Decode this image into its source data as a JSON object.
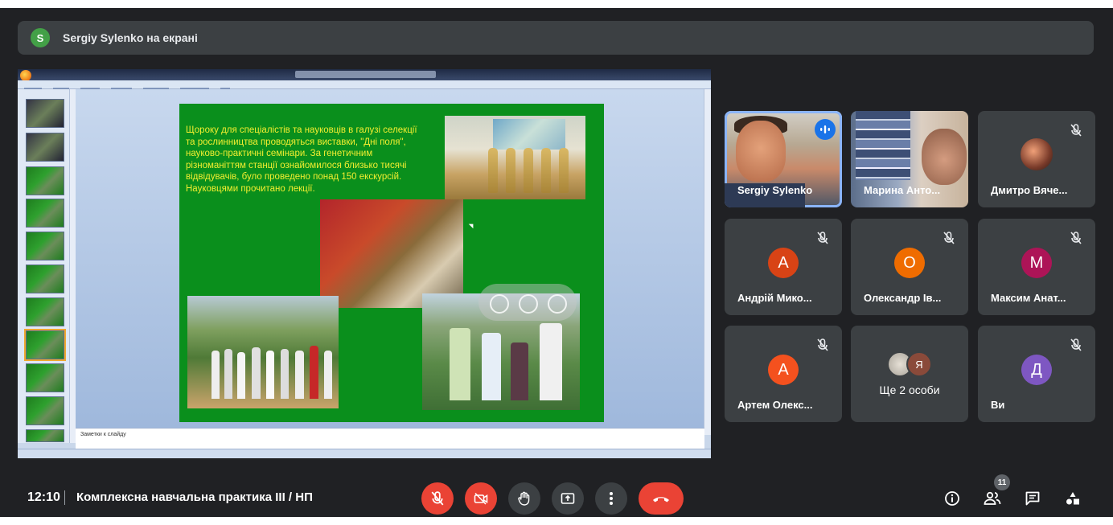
{
  "presenter": {
    "avatar_letter": "S",
    "text": "Sergiy Sylenko на екрані"
  },
  "shared_screen": {
    "slide_text": "Щороку для спеціалістів та науковців в галузі селекції та рослинництва проводяться виставки, \"Дні поля\", науково-практичні семінари. За генетичним різноманіттям станції ознайомилося близько тисячі відвідувачів, було проведено понад 150 екскурсій. Науковцями прочитано лекції.",
    "notes_placeholder": "Заметки к слайду"
  },
  "participants": [
    {
      "name": "Sergiy Sylenko",
      "type": "video",
      "speaking": true
    },
    {
      "name": "Марина Анто...",
      "type": "video"
    },
    {
      "name": "Дмитро Вяче...",
      "type": "photo",
      "muted": true
    },
    {
      "name": "Андрій Мико...",
      "letter": "А",
      "color": "#d84315",
      "muted": true
    },
    {
      "name": "Олександр Ів...",
      "letter": "О",
      "color": "#ef6c00",
      "muted": true
    },
    {
      "name": "Максим Анат...",
      "letter": "М",
      "color": "#ad1457",
      "muted": true
    },
    {
      "name": "Артем Олекс...",
      "letter": "А",
      "color": "#f4511e",
      "muted": true
    },
    {
      "name": "Ще 2 особи",
      "type": "more",
      "letter": "Я"
    },
    {
      "name": "Ви",
      "letter": "Д",
      "color": "#7e57c2",
      "muted": true
    }
  ],
  "bottom_bar": {
    "time": "12:10",
    "meeting_title": "Комплексна навчальна практика III / НП",
    "participants_count": "11"
  },
  "icons": [
    "mic-off-icon",
    "camera-off-icon",
    "raise-hand-icon",
    "present-icon",
    "more-options-icon",
    "end-call-icon",
    "info-icon",
    "people-icon",
    "chat-icon",
    "activities-icon"
  ]
}
